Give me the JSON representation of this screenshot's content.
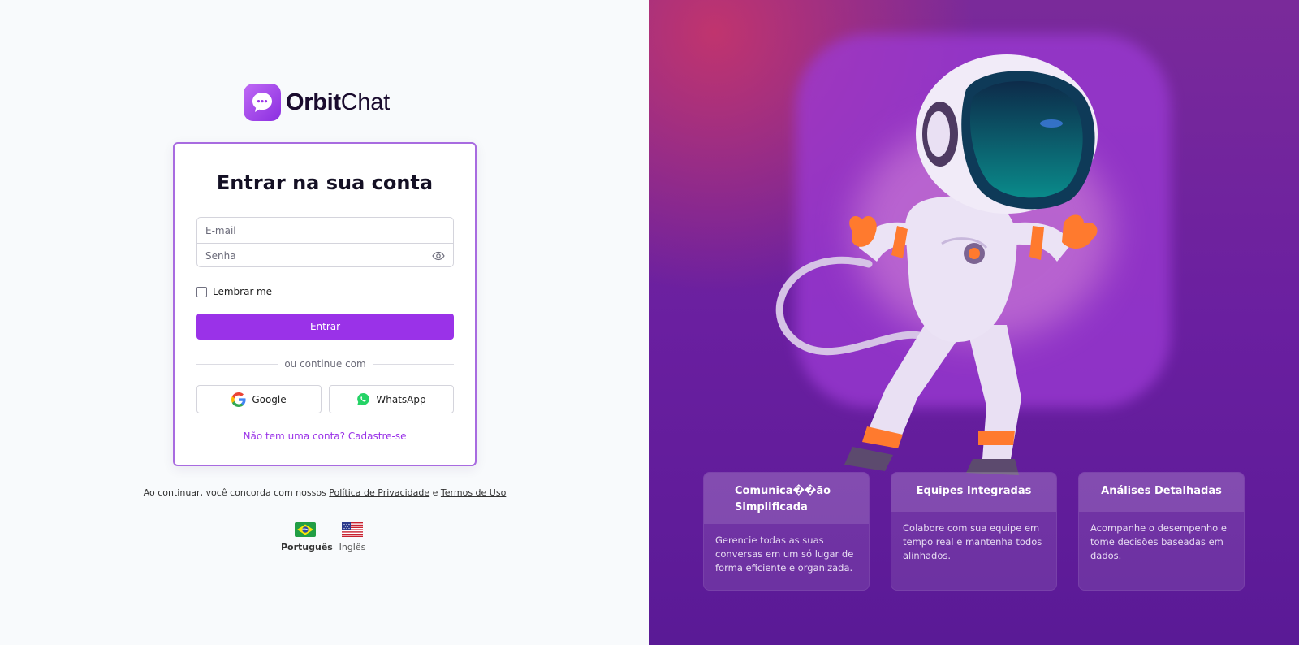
{
  "brand": {
    "name_bold": "Orbit",
    "name_regular": "Chat",
    "logo_icon": "chat-bubble-dots-icon"
  },
  "login": {
    "title": "Entrar na sua conta",
    "email_placeholder": "E-mail",
    "password_placeholder": "Senha",
    "remember_label": "Lembrar-me",
    "submit_label": "Entrar",
    "divider_text": "ou continue com",
    "google_label": "Google",
    "whatsapp_label": "WhatsApp",
    "signup_text": "Não tem uma conta? Cadastre-se"
  },
  "terms": {
    "prefix": "Ao continuar, você concorda com nossos",
    "privacy_link": "Política de Privacidade",
    "conjunction": "e",
    "terms_link": "Termos de Uso"
  },
  "languages": [
    {
      "label": "Português",
      "icon": "brazil-flag-icon",
      "selected": true
    },
    {
      "label": "Inglês",
      "icon": "us-flag-icon",
      "selected": false
    }
  ],
  "features": [
    {
      "title": "Comunica��ão Simplificada",
      "description": "Gerencie todas as suas conversas em um só lugar de forma eficiente e organizada."
    },
    {
      "title": "Equipes Integradas",
      "description": "Colabore com sua equipe em tempo real e mantenha todos alinhados."
    },
    {
      "title": "Análises Detalhadas",
      "description": "Acompanhe o desempenho e tome decisões baseadas em dados."
    }
  ],
  "colors": {
    "accent": "#9a32e8",
    "card_border": "#a86be0",
    "panel_bg": "#6a1fa0"
  }
}
